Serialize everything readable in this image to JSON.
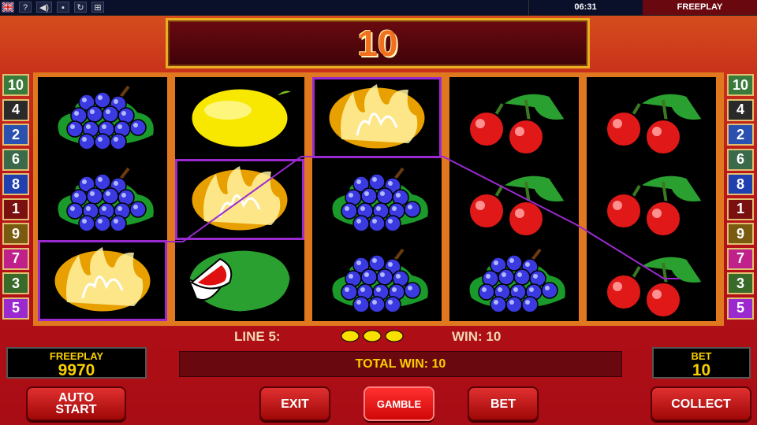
{
  "topbar": {
    "flag_icon": "uk-flag-icon",
    "help_label": "?",
    "clock": "06:31",
    "mode": "FREEPLAY"
  },
  "win_display": "10",
  "reels": [
    [
      "grapes",
      "grapes",
      "lemon"
    ],
    [
      "lemon",
      "lemon",
      "watermelon"
    ],
    [
      "lemon",
      "grapes",
      "grapes"
    ],
    [
      "cherries",
      "cherries",
      "grapes"
    ],
    [
      "cherries",
      "cherries",
      "cherries"
    ]
  ],
  "lines_left": [
    "10",
    "4",
    "2",
    "6",
    "8",
    "1",
    "9",
    "7",
    "3",
    "5"
  ],
  "lines_right": [
    "10",
    "4",
    "2",
    "6",
    "8",
    "1",
    "9",
    "7",
    "3",
    "5"
  ],
  "line_colors": [
    "#3a7a3a",
    "#2a2a2a",
    "#2a50b0",
    "#3a6a4a",
    "#2040b0",
    "#7a1010",
    "#7a5a10",
    "#c0208a",
    "#3a6a2a",
    "#9a2ad0"
  ],
  "info": {
    "line_label": "LINE 5:",
    "win_label": "WIN: 10",
    "total_win": "TOTAL WIN: 10"
  },
  "credit": {
    "label": "FREEPLAY",
    "value": "9970"
  },
  "bet": {
    "label": "BET",
    "value": "10"
  },
  "buttons": {
    "autostart_1": "AUTO",
    "autostart_2": "START",
    "exit": "EXIT",
    "gamble": "GAMBLE",
    "bet": "BET",
    "collect": "COLLECT"
  },
  "colors": {
    "highlight": "#9a2ad0",
    "frame": "#e07820",
    "accent": "#f8d000"
  }
}
